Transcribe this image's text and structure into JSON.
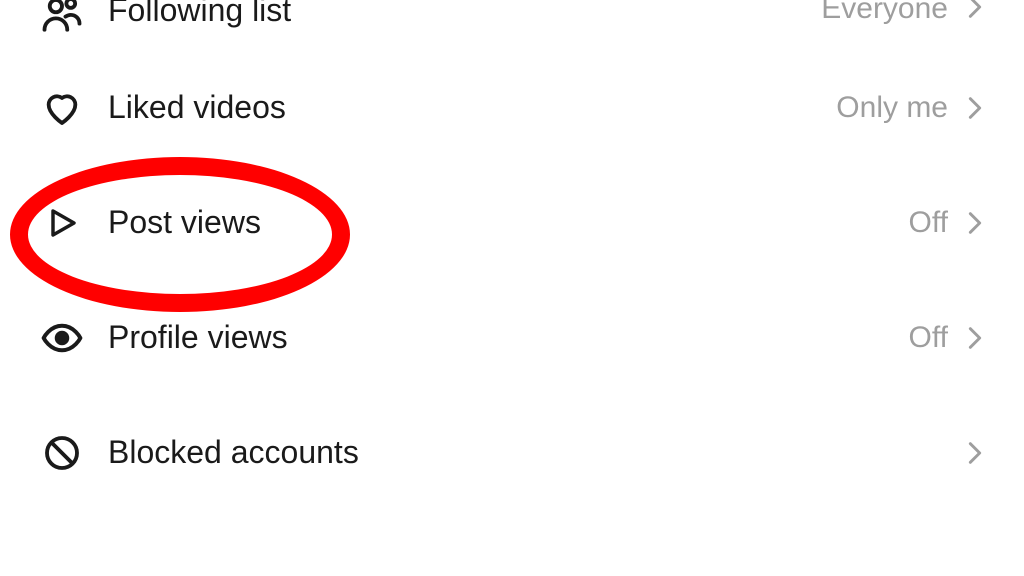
{
  "colors": {
    "text": "#1a1a1a",
    "value": "#9e9e9e",
    "highlight": "#ff0000"
  },
  "rows": {
    "followingList": {
      "label": "Following list",
      "value": "Everyone"
    },
    "likedVideos": {
      "label": "Liked videos",
      "value": "Only me"
    },
    "postViews": {
      "label": "Post views",
      "value": "Off"
    },
    "profileViews": {
      "label": "Profile views",
      "value": "Off"
    },
    "blockedAccounts": {
      "label": "Blocked accounts",
      "value": ""
    }
  }
}
